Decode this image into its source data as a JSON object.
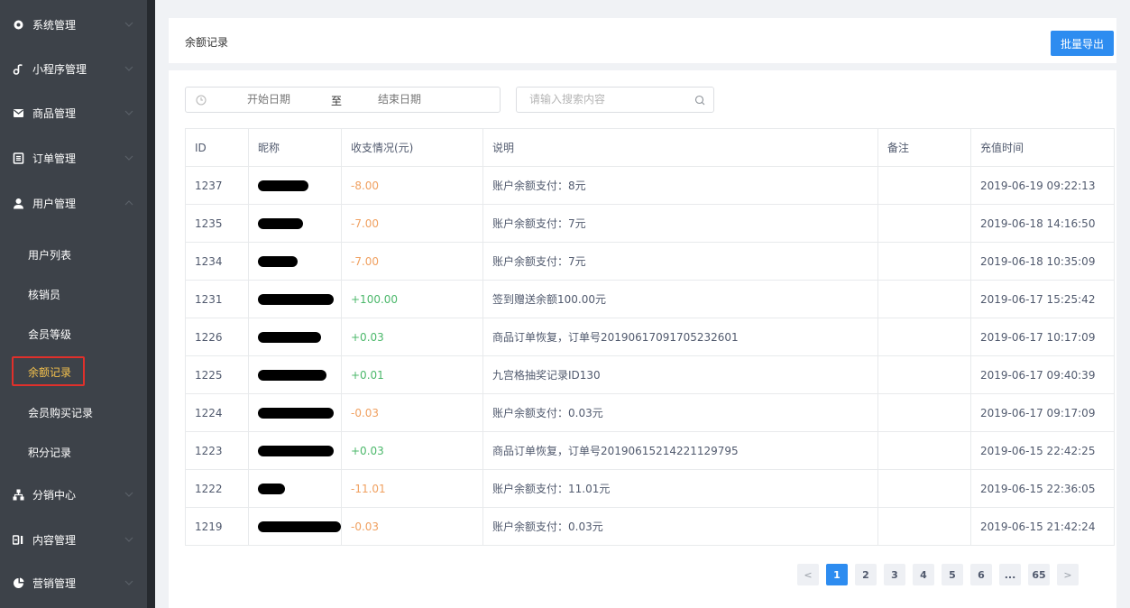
{
  "sidebar": {
    "items": [
      {
        "label": "系统管理",
        "icon": "gear-icon"
      },
      {
        "label": "小程序管理",
        "icon": "music-note-icon"
      },
      {
        "label": "商品管理",
        "icon": "envelope-icon"
      },
      {
        "label": "订单管理",
        "icon": "list-icon"
      },
      {
        "label": "用户管理",
        "icon": "user-icon"
      },
      {
        "label": "分销中心",
        "icon": "hierarchy-icon"
      },
      {
        "label": "内容管理",
        "icon": "content-icon"
      },
      {
        "label": "营销管理",
        "icon": "marketing-icon"
      }
    ],
    "sub_items": [
      {
        "label": "用户列表"
      },
      {
        "label": "核销员"
      },
      {
        "label": "会员等级"
      },
      {
        "label": "余额记录"
      },
      {
        "label": "会员购买记录"
      },
      {
        "label": "积分记录"
      }
    ]
  },
  "header": {
    "title": "余额记录",
    "export_label": "批量导出"
  },
  "filters": {
    "start_placeholder": "开始日期",
    "separator": "至",
    "end_placeholder": "结束日期",
    "search_placeholder": "请输入搜索内容"
  },
  "table": {
    "columns": [
      "ID",
      "昵称",
      "收支情况(元)",
      "说明",
      "备注",
      "充值时间"
    ],
    "rows": [
      {
        "id": "1237",
        "amount": "-8.00",
        "sign": "neg",
        "desc": "账户余额支付：8元",
        "note": "",
        "time": "2019-06-19 09:22:13"
      },
      {
        "id": "1235",
        "amount": "-7.00",
        "sign": "neg",
        "desc": "账户余额支付：7元",
        "note": "",
        "time": "2019-06-18 14:16:50"
      },
      {
        "id": "1234",
        "amount": "-7.00",
        "sign": "neg",
        "desc": "账户余额支付：7元",
        "note": "",
        "time": "2019-06-18 10:35:09"
      },
      {
        "id": "1231",
        "amount": "+100.00",
        "sign": "pos",
        "desc": "签到赠送余额100.00元",
        "note": "",
        "time": "2019-06-17 15:25:42"
      },
      {
        "id": "1226",
        "amount": "+0.03",
        "sign": "pos",
        "desc": "商品订单恢复，订单号20190617091705232601",
        "note": "",
        "time": "2019-06-17 10:17:09"
      },
      {
        "id": "1225",
        "amount": "+0.01",
        "sign": "pos",
        "desc": "九宫格抽奖记录ID130",
        "note": "",
        "time": "2019-06-17 09:40:39"
      },
      {
        "id": "1224",
        "amount": "-0.03",
        "sign": "neg",
        "desc": "账户余额支付：0.03元",
        "note": "",
        "time": "2019-06-17 09:17:09"
      },
      {
        "id": "1223",
        "amount": "+0.03",
        "sign": "pos",
        "desc": "商品订单恢复，订单号20190615214221129795",
        "note": "",
        "time": "2019-06-15 22:42:25"
      },
      {
        "id": "1222",
        "amount": "-11.01",
        "sign": "neg",
        "desc": "账户余额支付：11.01元",
        "note": "",
        "time": "2019-06-15 22:36:05"
      },
      {
        "id": "1219",
        "amount": "-0.03",
        "sign": "neg",
        "desc": "账户余额支付：0.03元",
        "note": "",
        "time": "2019-06-15 21:42:24"
      }
    ]
  },
  "pagination": {
    "prev": "<",
    "pages": [
      "1",
      "2",
      "3",
      "4",
      "5",
      "6",
      "...",
      "65"
    ],
    "current": "1",
    "next": ">"
  },
  "colors": {
    "accent": "#2d8cf0",
    "negative": "#f0a060",
    "positive": "#4cb86b",
    "active_sub": "#f5c24d",
    "highlight_box": "#e0302b"
  }
}
